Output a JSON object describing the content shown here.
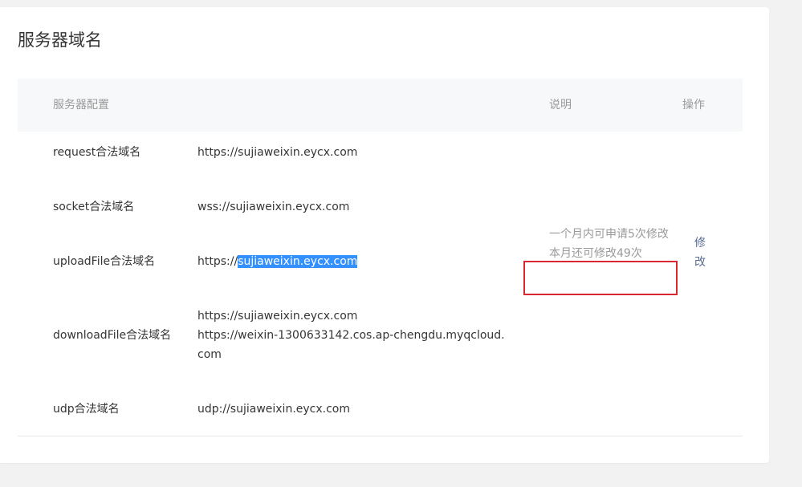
{
  "page_title": "服务器域名",
  "table": {
    "headers": {
      "config": "服务器配置",
      "description": "说明",
      "operation": "操作"
    },
    "rows": [
      {
        "label": "request合法域名",
        "values": [
          "https://sujiaweixin.eycx.com"
        ]
      },
      {
        "label": "socket合法域名",
        "values": [
          "wss://sujiaweixin.eycx.com"
        ]
      },
      {
        "label": "uploadFile合法域名",
        "value_prefix": "https://",
        "value_selected": "sujiaweixin.eycx.com"
      },
      {
        "label": "downloadFile合法域名",
        "values": [
          "https://sujiaweixin.eycx.com",
          "https://weixin-1300633142.cos.ap-chengdu.myqcloud.com"
        ]
      },
      {
        "label": "udp合法域名",
        "values": [
          "udp://sujiaweixin.eycx.com"
        ]
      }
    ],
    "description": {
      "line1": "一个月内可申请5次修改",
      "line2": "本月还可修改49次"
    },
    "operation_label": "修改"
  },
  "colors": {
    "selection": "#3390ff",
    "annotation": "#d9282f",
    "link": "#576b95"
  }
}
